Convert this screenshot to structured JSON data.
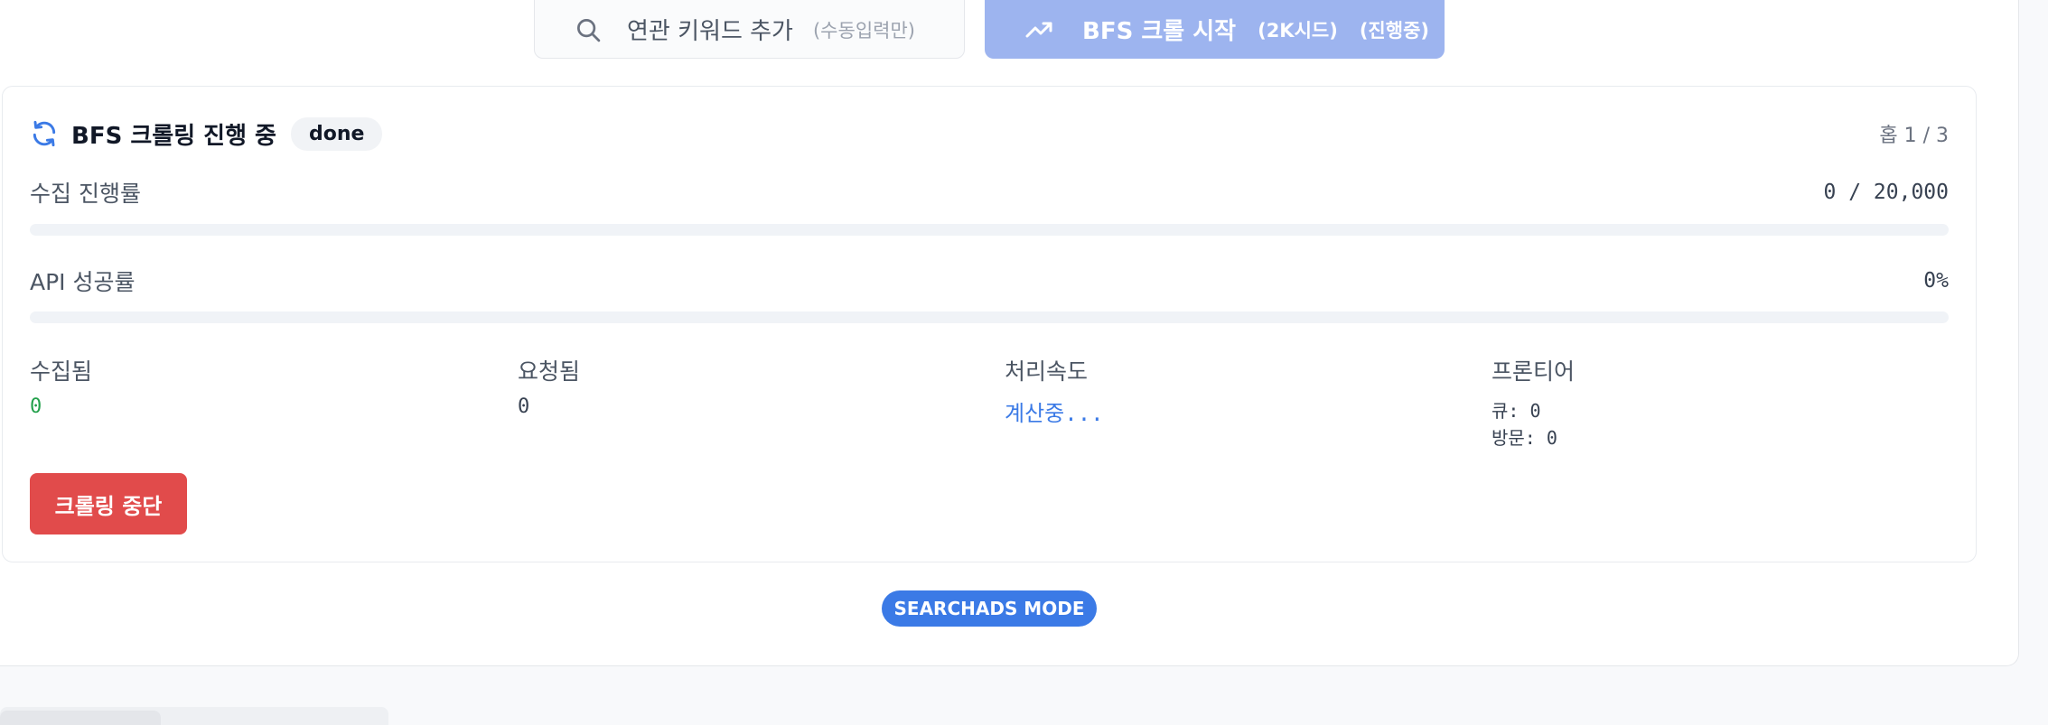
{
  "top_actions": {
    "keyword_button": {
      "label": "연관 키워드 추가",
      "sub": "(수동입력만)",
      "icon": "search-icon"
    },
    "bfs_button": {
      "label": "BFS 크롤 시작",
      "sub1": "(2K시드)",
      "sub2": "(진행중)",
      "icon": "trending-up-icon",
      "color": "#9db4ef"
    }
  },
  "crawl": {
    "title": "BFS 크롤링 진행 중",
    "status_badge": "done",
    "page_indicator": "홉 1 / 3",
    "progress": {
      "label": "수집 진행률",
      "value": "0 / 20,000",
      "fraction": 0
    },
    "api_success": {
      "label": "API 성공률",
      "value": "0%",
      "fraction": 0
    },
    "stats": {
      "collected": {
        "label": "수집됨",
        "value": "0"
      },
      "requested": {
        "label": "요청됨",
        "value": "0"
      },
      "speed": {
        "label": "처리속도",
        "value": "계산중..."
      },
      "frontier": {
        "label": "프론티어",
        "queue": "큐: 0",
        "visited": "방문: 0"
      }
    },
    "stop_button": {
      "label": "크롤링 중단",
      "color": "#e14b4b"
    }
  },
  "mode_badge": {
    "label": "SEARCHADS MODE",
    "color": "#3b7ae6"
  }
}
